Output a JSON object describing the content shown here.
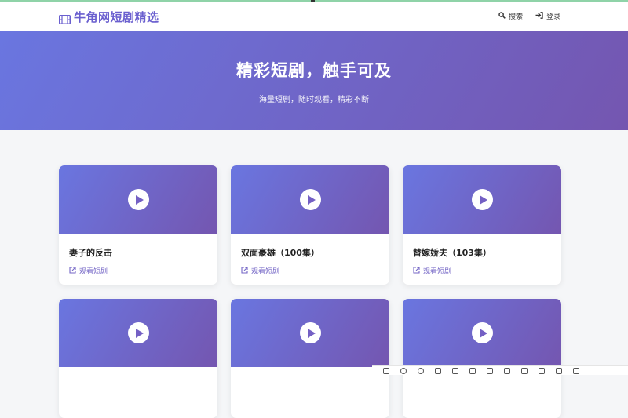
{
  "header": {
    "brand": "牛角网短剧精选",
    "nav": {
      "search": "搜索",
      "login": "登录"
    }
  },
  "hero": {
    "title": "精彩短剧，触手可及",
    "subtitle": "海量短剧，随时观看，精彩不断"
  },
  "cards": [
    {
      "title": "妻子的反击",
      "link": "观看短剧"
    },
    {
      "title": "双面豪雄（100集）",
      "link": "观看短剧"
    },
    {
      "title": "替嫁娇夫（103集）",
      "link": "观看短剧"
    },
    {
      "title": "",
      "link": ""
    },
    {
      "title": "",
      "link": ""
    },
    {
      "title": "",
      "link": ""
    }
  ],
  "colors": {
    "accent": "#6a5fcf",
    "gradient_start": "#6a76e0",
    "gradient_end": "#7456b0"
  },
  "icons": {
    "brand": "film-icon",
    "search": "search-icon",
    "login": "sign-in-icon",
    "play": "play-icon",
    "link": "external-link-icon"
  }
}
